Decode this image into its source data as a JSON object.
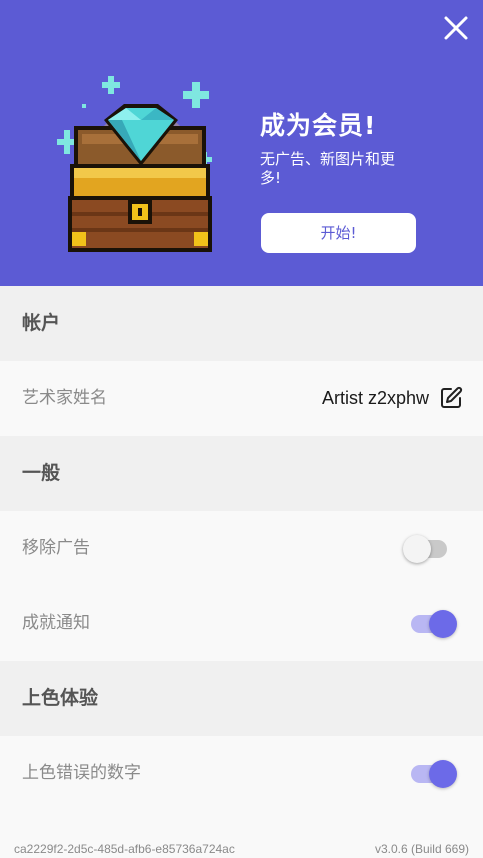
{
  "promo": {
    "title": "成为会员!",
    "subtitle": "无广告、新图片和更多!",
    "start_label": "开始!",
    "bg_color": "#5c5bd4"
  },
  "sections": {
    "account": "帐户",
    "general": "一般",
    "coloring": "上色体验"
  },
  "settings": {
    "artist_name_label": "艺术家姓名",
    "artist_name_value": "Artist z2xphw",
    "remove_ads_label": "移除广告",
    "remove_ads_on": false,
    "achievement_label": "成就通知",
    "achievement_on": true,
    "color_errors_label": "上色错误的数字",
    "color_errors_on": true
  },
  "footer": {
    "device_id": "ca2229f2-2d5c-485d-afb6-e85736a724ac",
    "version": "v3.0.6 (Build 669)"
  },
  "icons": [
    "close-icon",
    "treasure-chest-icon",
    "edit-icon"
  ]
}
